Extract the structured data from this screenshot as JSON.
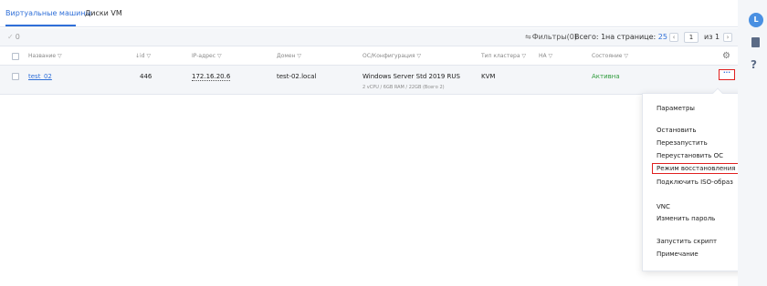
{
  "tabs": [
    {
      "label": "Виртуальные машины",
      "active": true
    },
    {
      "label": "Диски VM",
      "active": false
    }
  ],
  "toolbar": {
    "selected_count": "0",
    "filters_label": "Фильтры(0)",
    "total_label": "Всего: 1",
    "per_page_label": "на странице:",
    "per_page_value": "25",
    "page_input": "1",
    "page_of": "из 1",
    "prev_icon": "chevron-left-icon",
    "next_icon": "chevron-right-icon"
  },
  "table": {
    "headers": [
      {
        "key": "name",
        "label": "Название"
      },
      {
        "key": "id",
        "label": "id"
      },
      {
        "key": "ip",
        "label": "IP-адрес"
      },
      {
        "key": "domain",
        "label": "Домен"
      },
      {
        "key": "os",
        "label": "ОС/Конфигурация"
      },
      {
        "key": "cluster",
        "label": "Тип кластера"
      },
      {
        "key": "ha",
        "label": "HA"
      },
      {
        "key": "state",
        "label": "Состояние"
      }
    ],
    "rows": [
      {
        "name": "test_02",
        "id": "446",
        "ip": "172.16.20.6",
        "domain": "test-02.local",
        "os": "Windows Server Std 2019 RUS",
        "config": "2 vCPU / 6GB RAM / 22GB (Всего 2)",
        "cluster": "KVM",
        "ha": "",
        "state": "Активна"
      }
    ],
    "row_menu_label": "···"
  },
  "menu": {
    "title": "Параметры",
    "items": [
      "Остановить",
      "Перезапустить",
      "Переустановить ОС",
      "Режим восстановления",
      "Подключить ISO-образ",
      "VNC",
      "Изменить пароль",
      "Запустить скрипт",
      "Примечание"
    ],
    "highlighted": "Режим восстановления"
  },
  "sidebar": {
    "avatar_letter": "L",
    "icons": [
      "book-icon",
      "help-icon"
    ]
  },
  "colors": {
    "accent": "#2f6fd8",
    "highlight": "#e02020",
    "active_state": "#2e9b3b"
  }
}
